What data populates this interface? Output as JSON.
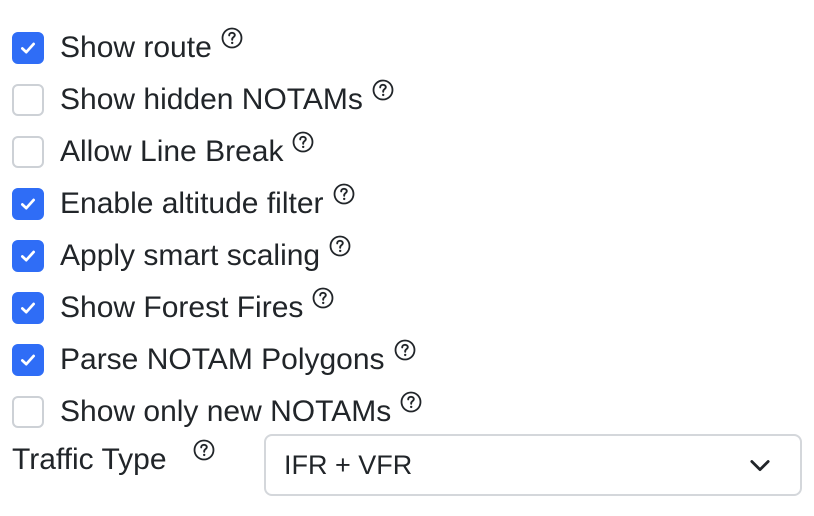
{
  "options": [
    {
      "label": "Show route",
      "checked": true
    },
    {
      "label": "Show hidden NOTAMs",
      "checked": false
    },
    {
      "label": "Allow Line Break",
      "checked": false
    },
    {
      "label": "Enable altitude filter",
      "checked": true
    },
    {
      "label": "Apply smart scaling",
      "checked": true
    },
    {
      "label": "Show Forest Fires",
      "checked": true
    },
    {
      "label": "Parse NOTAM Polygons",
      "checked": true
    },
    {
      "label": "Show only new NOTAMs",
      "checked": false
    }
  ],
  "traffic": {
    "label": "Traffic Type",
    "selected": "IFR + VFR"
  },
  "icons": {
    "help": "question-circle-icon",
    "check": "check-icon",
    "chevron": "chevron-down-icon"
  },
  "colors": {
    "accent": "#2f6df6",
    "text": "#212529",
    "border": "#cdd1d6"
  }
}
